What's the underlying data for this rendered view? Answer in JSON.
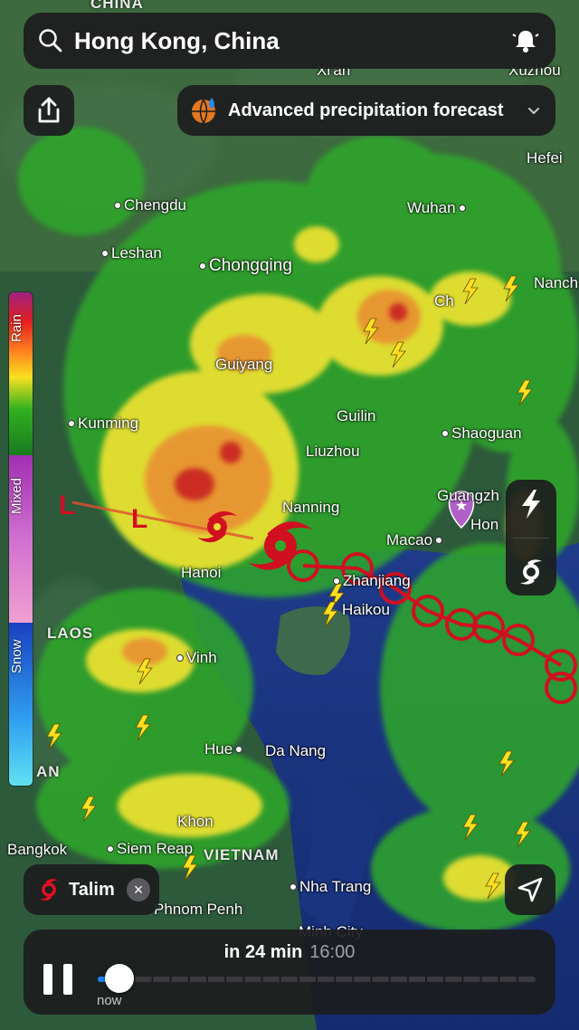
{
  "search": {
    "location": "Hong Kong, China"
  },
  "layer": {
    "label": "Advanced precipitation forecast"
  },
  "legend": {
    "rain": "Rain",
    "mixed": "Mixed",
    "snow": "Snow"
  },
  "cities": {
    "china": "CHINA",
    "xian": "Xi'an",
    "xuzhou": "Xuzhou",
    "hefei": "Hefei",
    "chengdu": "Chengdu",
    "wuhan": "Wuhan",
    "leshan": "Leshan",
    "chongqing": "Chongqing",
    "nanch": "Nanch",
    "changsha": "Ch",
    "guiyang": "Guiyang",
    "guilin": "Guilin",
    "kunming": "Kunming",
    "liuzhou": "Liuzhou",
    "shaoguan": "Shaoguan",
    "nanning": "Nanning",
    "guangzhou": "Guangzh",
    "hong": "Hon",
    "macao": "Macao",
    "hanoi": "Hanoi",
    "zhanjiang": "Zhanjiang",
    "haikou": "Haikou",
    "laos": "LAOS",
    "vinh": "Vinh",
    "hue": "Hue",
    "danang": "Da Nang",
    "an": "AN",
    "bangkok": "Bangkok",
    "siemreap": "Siem Reap",
    "vietnam": "VIETNAM",
    "khon": "Khon",
    "nhatrang": "Nha Trang",
    "phnompenh": "Phnom Penh",
    "minhcity": "Minh City"
  },
  "storm": {
    "name": "Talim",
    "low_marker": "L"
  },
  "player": {
    "time_relative": "in 24 min",
    "time_clock": "16:00",
    "now_label": "now",
    "position_fraction": 0.05
  },
  "colors": {
    "panel": "#1c1c1e",
    "accent": "#1a84ff",
    "storm_track": "#d01020"
  }
}
